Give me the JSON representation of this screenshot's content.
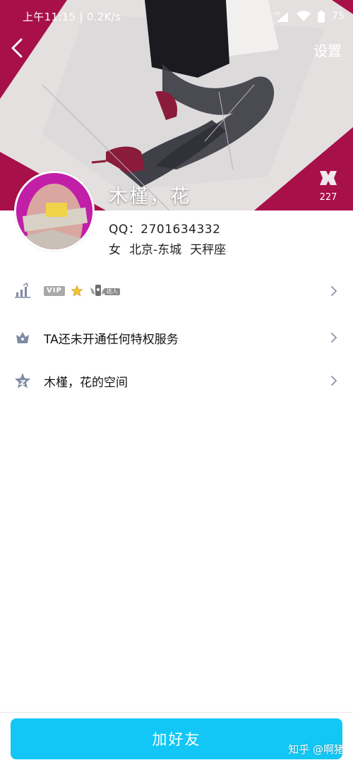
{
  "status_bar": {
    "time_speed": "上午11:15 | 0.2K/s",
    "battery": "75",
    "icons": [
      "hd-icon",
      "signal-icon",
      "wifi-icon",
      "battery-icon"
    ]
  },
  "header": {
    "back_icon": "chevron-left-icon",
    "settings_label": "设置",
    "like_count": "227",
    "nickname": "木槿，花"
  },
  "profile": {
    "qq": "QQ：2701634332",
    "gender": "女",
    "location": "北京-东城",
    "zodiac": "天秤座"
  },
  "rows": [
    {
      "icon": "level-up-icon",
      "badges": {
        "vip": "VIP",
        "daren": "达人"
      }
    },
    {
      "icon": "crown-icon",
      "label": "TA还未开通任何特权服务"
    },
    {
      "icon": "star-icon",
      "label": "木槿，花的空间"
    }
  ],
  "footer": {
    "add_friend_label": "加好友",
    "watermark": "知乎 @啊猪"
  },
  "colors": {
    "cover_bg": "#a8104a",
    "accent": "#12c7f5",
    "icon_gray": "#7f8aa3",
    "avatar_bg": "#c21fa9"
  }
}
